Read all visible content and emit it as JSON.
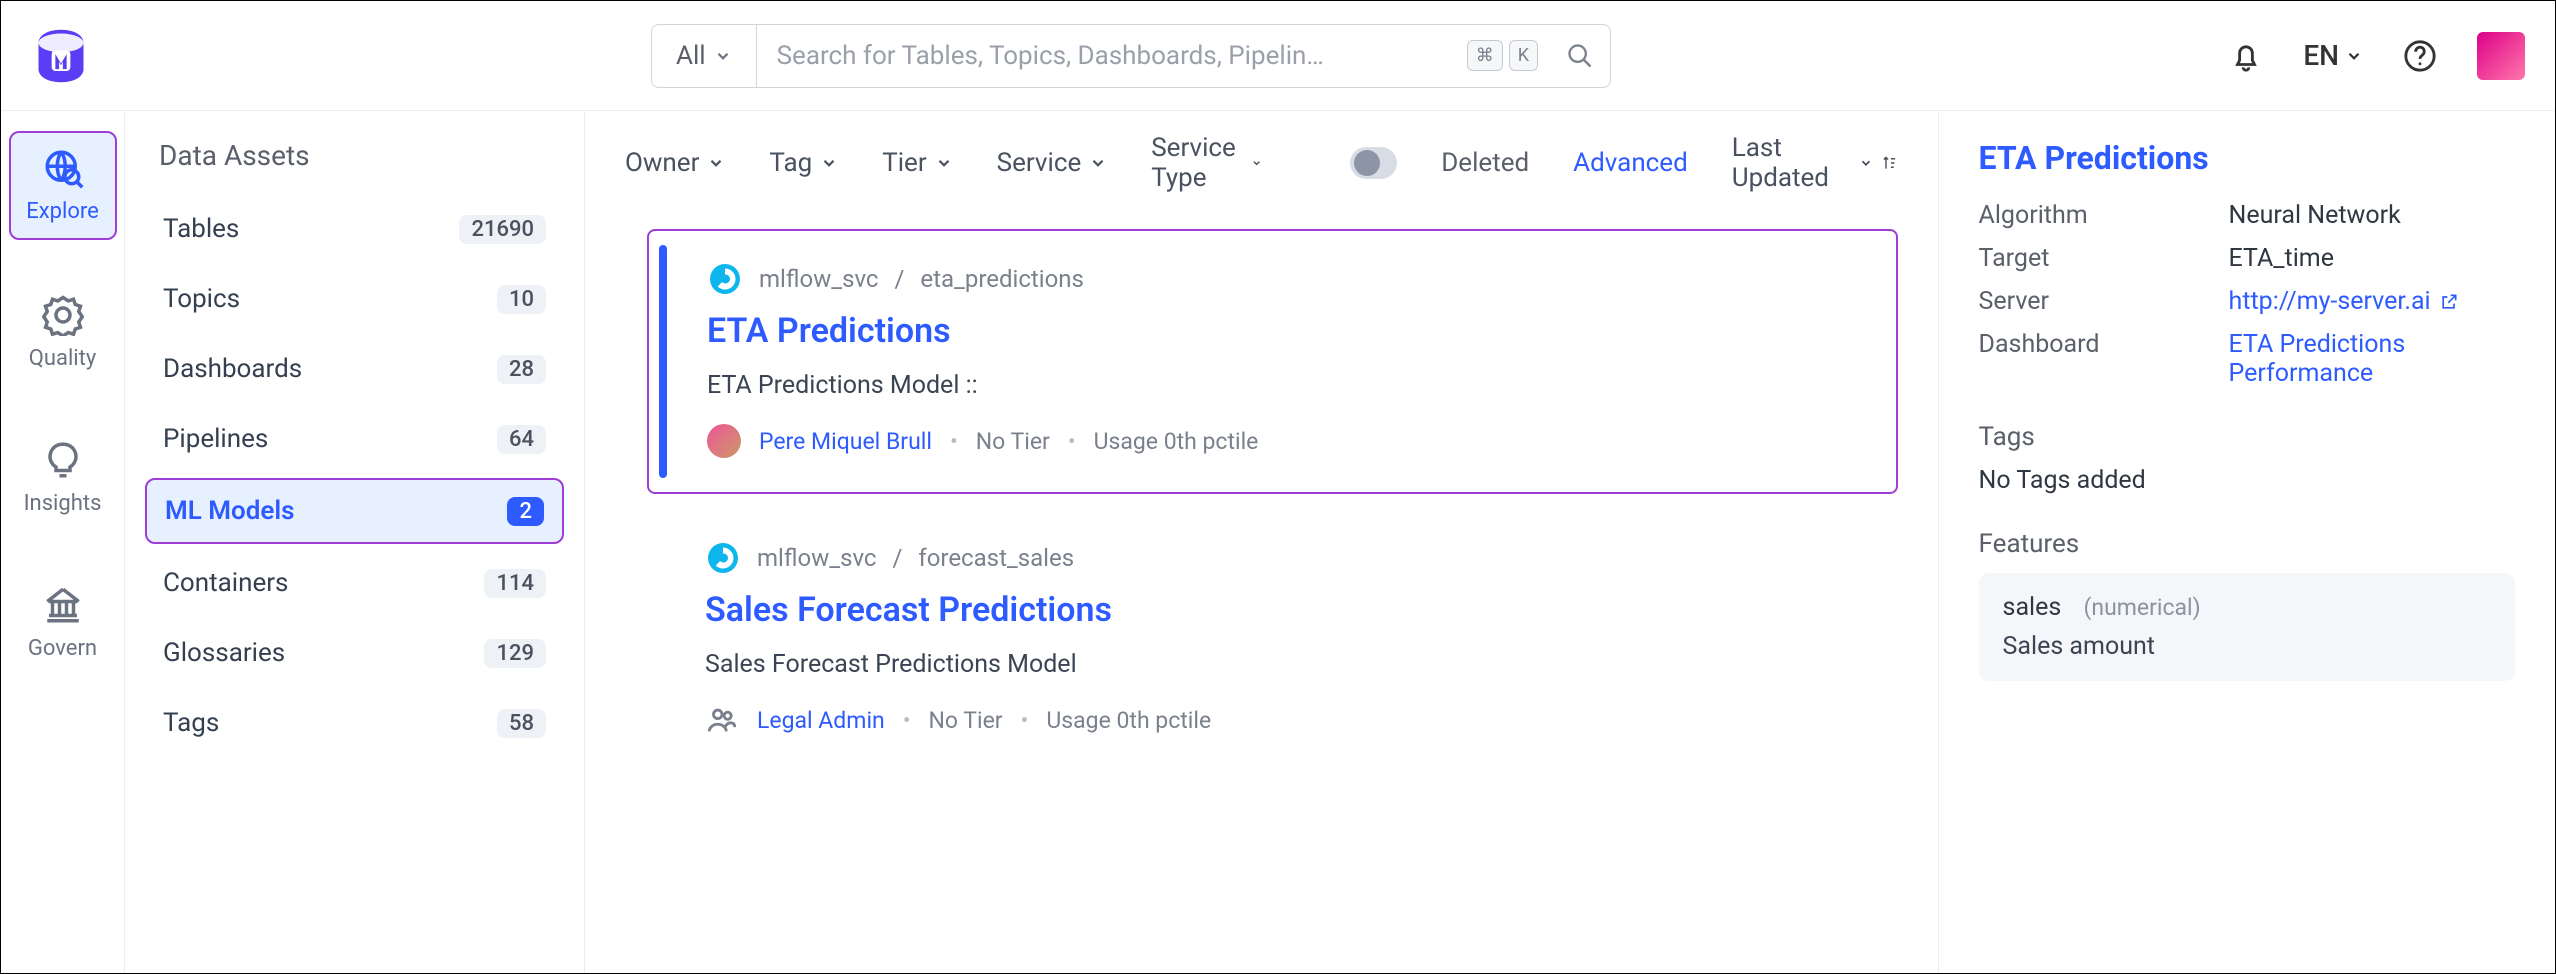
{
  "topbar": {
    "scope_label": "All",
    "search_placeholder": "Search for Tables, Topics, Dashboards, Pipelin…",
    "kbd1": "⌘",
    "kbd2": "K",
    "lang": "EN"
  },
  "rail": [
    {
      "label": "Explore",
      "active": true,
      "icon": "globe-search-icon"
    },
    {
      "label": "Quality",
      "active": false,
      "icon": "badge-icon"
    },
    {
      "label": "Insights",
      "active": false,
      "icon": "bulb-icon"
    },
    {
      "label": "Govern",
      "active": false,
      "icon": "govern-icon"
    }
  ],
  "assets": {
    "title": "Data Assets",
    "items": [
      {
        "label": "Tables",
        "count": "21690",
        "active": false
      },
      {
        "label": "Topics",
        "count": "10",
        "active": false
      },
      {
        "label": "Dashboards",
        "count": "28",
        "active": false
      },
      {
        "label": "Pipelines",
        "count": "64",
        "active": false
      },
      {
        "label": "ML Models",
        "count": "2",
        "active": true
      },
      {
        "label": "Containers",
        "count": "114",
        "active": false
      },
      {
        "label": "Glossaries",
        "count": "129",
        "active": false
      },
      {
        "label": "Tags",
        "count": "58",
        "active": false
      }
    ]
  },
  "filters": {
    "items": [
      "Owner",
      "Tag",
      "Tier",
      "Service",
      "Service Type"
    ],
    "deleted_label": "Deleted",
    "advanced_label": "Advanced",
    "sort_label": "Last Updated"
  },
  "results": [
    {
      "service": "mlflow_svc",
      "path": "eta_predictions",
      "title": "ETA Predictions",
      "desc": "ETA Predictions Model ::",
      "owner": "Pere Miquel Brull",
      "tier": "No Tier",
      "usage": "Usage 0th pctile",
      "selected": true,
      "owner_icon": "avatar"
    },
    {
      "service": "mlflow_svc",
      "path": "forecast_sales",
      "title": "Sales Forecast Predictions",
      "desc": "Sales Forecast Predictions Model",
      "owner": "Legal Admin",
      "tier": "No Tier",
      "usage": "Usage 0th pctile",
      "selected": false,
      "owner_icon": "group"
    }
  ],
  "detail": {
    "title": "ETA Predictions",
    "rows": [
      {
        "k": "Algorithm",
        "v": "Neural Network",
        "link": false
      },
      {
        "k": "Target",
        "v": "ETA_time",
        "link": false
      },
      {
        "k": "Server",
        "v": "http://my-server.ai",
        "link": true
      },
      {
        "k": "Dashboard",
        "v": "ETA Predictions Performance",
        "link": true
      }
    ],
    "tags_head": "Tags",
    "tags_empty": "No Tags added",
    "features_head": "Features",
    "feature": {
      "name": "sales",
      "type": "(numerical)",
      "desc": "Sales amount"
    }
  }
}
